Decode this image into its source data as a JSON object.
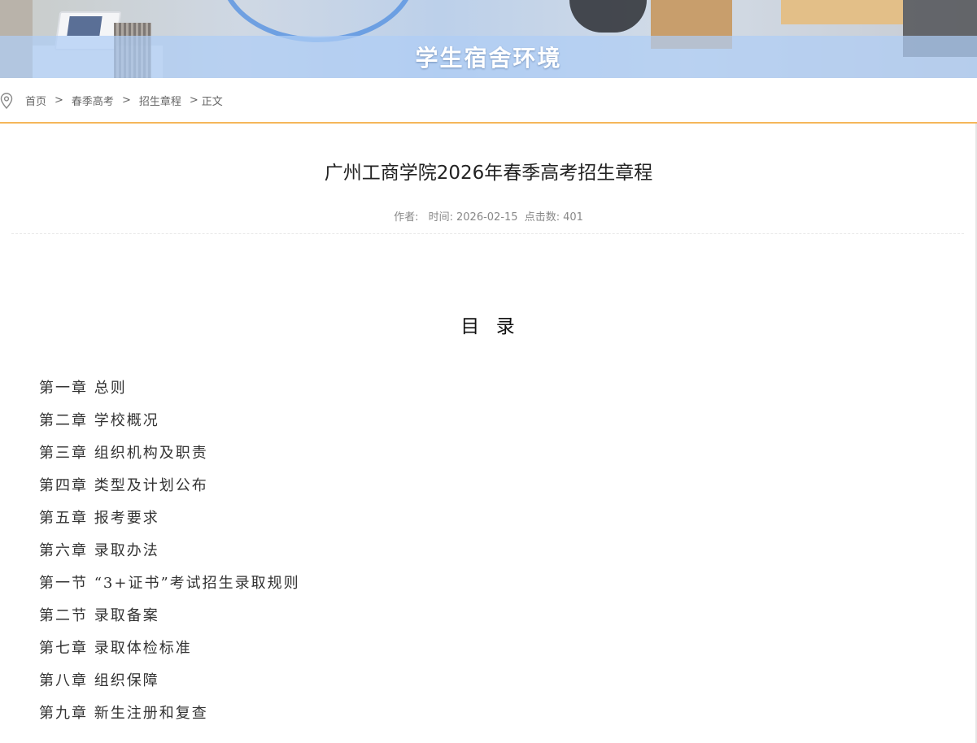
{
  "banner": {
    "title": "学生宿舍环境"
  },
  "icons": {
    "location": "map-pin-icon"
  },
  "colors": {
    "accent_line": "#f5b75a",
    "banner_blue": "#4f8de0"
  },
  "breadcrumb": {
    "items": [
      "首页",
      "春季高考",
      "招生章程"
    ],
    "separator": ">",
    "current": "正文"
  },
  "article": {
    "title": "广州工商学院2026年春季高考招生章程",
    "meta": {
      "author_label": "作者:",
      "author": "",
      "time_label": "时间:",
      "time": "2026-02-15",
      "clicks_label": "点击数:",
      "clicks": "401"
    }
  },
  "toc": {
    "heading": "目  录",
    "items": [
      "第一章 总则",
      "第二章 学校概况",
      "第三章 组织机构及职责",
      "第四章 类型及计划公布",
      "第五章 报考要求",
      "第六章 录取办法",
      "第一节 “3+证书”考试招生录取规则",
      "第二节 录取备案",
      "第七章 录取体检标准",
      "第八章 组织保障",
      "第九章 新生注册和复查"
    ]
  }
}
